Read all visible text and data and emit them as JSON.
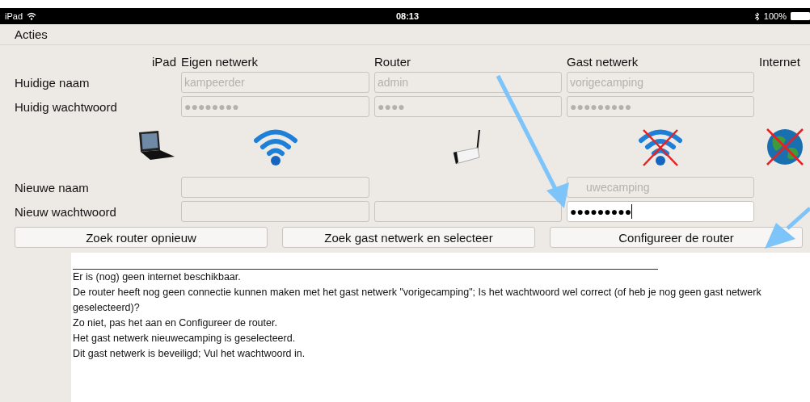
{
  "status_bar": {
    "device": "iPad",
    "time": "08:13",
    "battery": "100%"
  },
  "menu": {
    "label": "Acties"
  },
  "columns": [
    "iPad",
    "Eigen netwerk",
    "Router",
    "Gast netwerk",
    "Internet"
  ],
  "current_rows": [
    {
      "label": "Huidige naam",
      "cells": [
        {
          "kind": "field",
          "value": "kampeerder",
          "disabled": true,
          "focused": false
        },
        {
          "kind": "field",
          "value": "admin",
          "disabled": true,
          "focused": false
        },
        {
          "kind": "field",
          "value": "vorigecamping",
          "disabled": true,
          "focused": false
        }
      ]
    },
    {
      "label": "Huidig wachtwoord",
      "cells": [
        {
          "kind": "field",
          "value": "●●●●●●●●",
          "disabled": true,
          "focused": false
        },
        {
          "kind": "field",
          "value": "●●●●",
          "disabled": true,
          "focused": false
        },
        {
          "kind": "field",
          "value": "●●●●●●●●●",
          "disabled": true,
          "focused": false
        }
      ]
    }
  ],
  "devices": [
    {
      "kind": "laptop",
      "crossed": false
    },
    {
      "kind": "wifi",
      "crossed": false
    },
    {
      "kind": "router",
      "crossed": false
    },
    {
      "kind": "wifi",
      "crossed": true
    },
    {
      "kind": "globe",
      "crossed": true
    }
  ],
  "new_rows": [
    {
      "label": "Nieuwe naam",
      "cells": [
        {
          "kind": "field",
          "focused": false
        },
        {
          "kind": "none"
        },
        {
          "kind": "field",
          "value": "uwecamping",
          "disabled": true,
          "focused": false
        }
      ]
    },
    {
      "label": "Nieuw wachtwoord",
      "cells": [
        {
          "kind": "field",
          "focused": false
        },
        {
          "kind": "field",
          "focused": false
        },
        {
          "kind": "field",
          "value": "●●●●●●●●●",
          "focused": true
        }
      ]
    }
  ],
  "buttons": [
    "Zoek router opnieuw",
    "Zoek gast netwerk en selecteer",
    "Configureer de router"
  ],
  "log": [
    "Er is (nog) geen internet beschikbaar.",
    "De router heeft nog geen connectie kunnen maken met het gast netwerk \"vorigecamping\"; Is het wachtwoord wel correct (of heb je nog geen gast netwerk geselecteerd)?",
    "Zo niet, pas het aan en Configureer de router.",
    "Het gast netwerk nieuwecamping is geselecteerd.",
    "Dit gast netwerk is beveiligd; Vul het wachtwoord in."
  ]
}
